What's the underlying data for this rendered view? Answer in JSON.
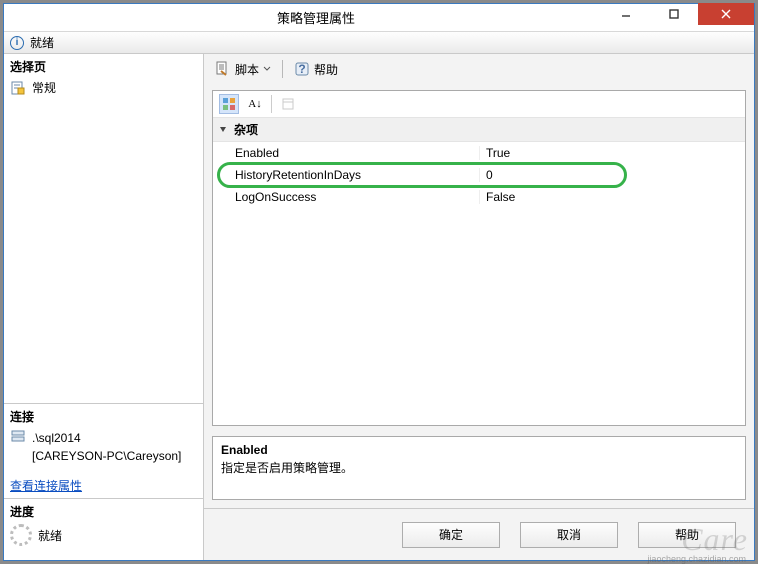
{
  "window": {
    "title": "策略管理属性"
  },
  "status": {
    "text": "就绪"
  },
  "sidebar": {
    "select_page_header": "选择页",
    "general_item": "常规",
    "connection_header": "连接",
    "server_line1": ".\\sql2014",
    "server_line2": "[CAREYSON-PC\\Careyson]",
    "view_conn_link": "查看连接属性",
    "progress_header": "进度",
    "progress_status": "就绪"
  },
  "toolbar": {
    "script_label": "脚本",
    "help_label": "帮助"
  },
  "propgrid": {
    "category": "杂项",
    "rows": [
      {
        "name": "Enabled",
        "value": "True"
      },
      {
        "name": "HistoryRetentionInDays",
        "value": "0"
      },
      {
        "name": "LogOnSuccess",
        "value": "False"
      }
    ]
  },
  "description": {
    "title": "Enabled",
    "text": "指定是否启用策略管理。"
  },
  "buttons": {
    "ok": "确定",
    "cancel": "取消",
    "help": "帮助"
  },
  "watermark": {
    "main": "Care",
    "sub": "jiaocheng.chazidian.com"
  }
}
